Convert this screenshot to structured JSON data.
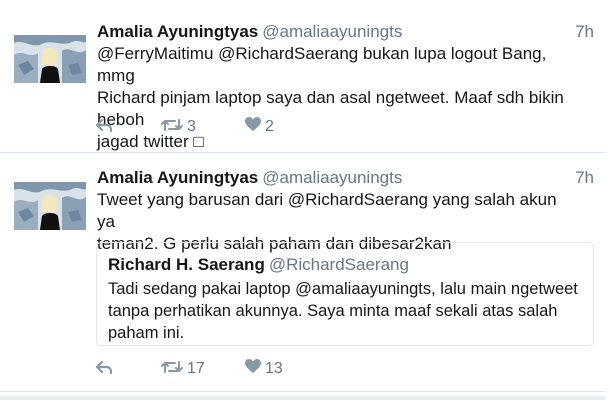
{
  "tweets": [
    {
      "name": "Amalia Ayuningtyas",
      "handle": "@amaliaayuningts",
      "time": "7h",
      "text_lines": [
        "@FerryMaitimu @RichardSaerang bukan lupa logout Bang, mmg",
        "Richard pinjam laptop saya dan asal ngetweet. Maaf sdh bikin heboh",
        "jagad twitter □"
      ],
      "actions": {
        "reply_icon": "reply-icon",
        "retweet_count": "3",
        "like_count": "2"
      }
    },
    {
      "name": "Amalia Ayuningtyas",
      "handle": "@amaliaayuningts",
      "time": "7h",
      "text_lines": [
        "Tweet yang barusan dari @RichardSaerang yang salah akun ya",
        "teman2. G perlu salah paham dan dibesar2kan"
      ],
      "quote": {
        "name": "Richard H. Saerang",
        "handle": "@RichardSaerang",
        "text_lines": [
          "Tadi sedang pakai laptop @amaliaayuningts, lalu main ngetweet",
          "tanpa perhatikan akunnya. Saya minta maaf sekali atas salah",
          "paham ini."
        ]
      },
      "actions": {
        "reply_icon": "reply-icon",
        "retweet_count": "17",
        "like_count": "13"
      }
    }
  ],
  "colors": {
    "text": "#14171a",
    "secondary": "#657786",
    "icon": "#8899a6",
    "border": "#e1e8ed"
  }
}
